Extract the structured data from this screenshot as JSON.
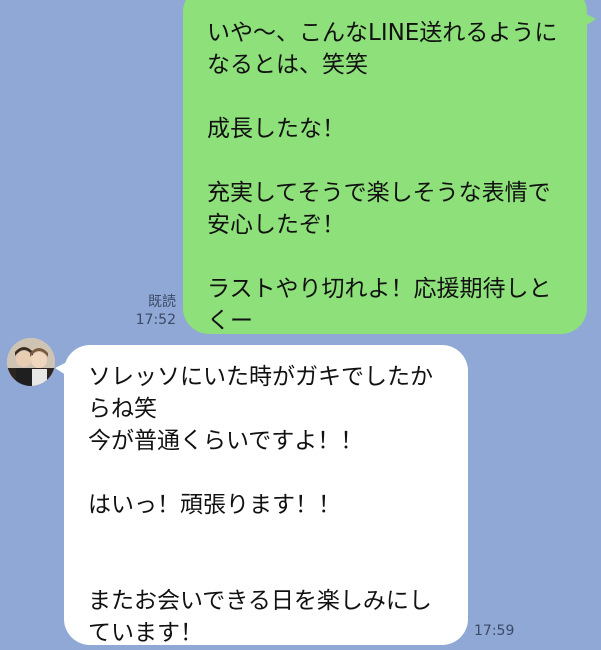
{
  "messages": {
    "outgoing": {
      "text": "いや〜、こんなLINE送れるようになるとは、笑笑\n\n成長したな！\n\n充実してそうで楽しそうな表情で安心したぞ！\n\nラストやり切れよ！応援期待しとくー",
      "read_label": "既読",
      "time": "17:52"
    },
    "incoming": {
      "avatar_icon": "profile-photo",
      "text": "ソレッソにいた時がガキでしたからね笑\n今が普通くらいですよ！！\n\nはいっ！頑張ります！！\n\n\nまたお会いできる日を楽しみにしています！",
      "time": "17:59"
    }
  },
  "colors": {
    "background": "#8fa8d6",
    "outgoing_bubble": "#8de07a",
    "incoming_bubble": "#ffffff"
  }
}
